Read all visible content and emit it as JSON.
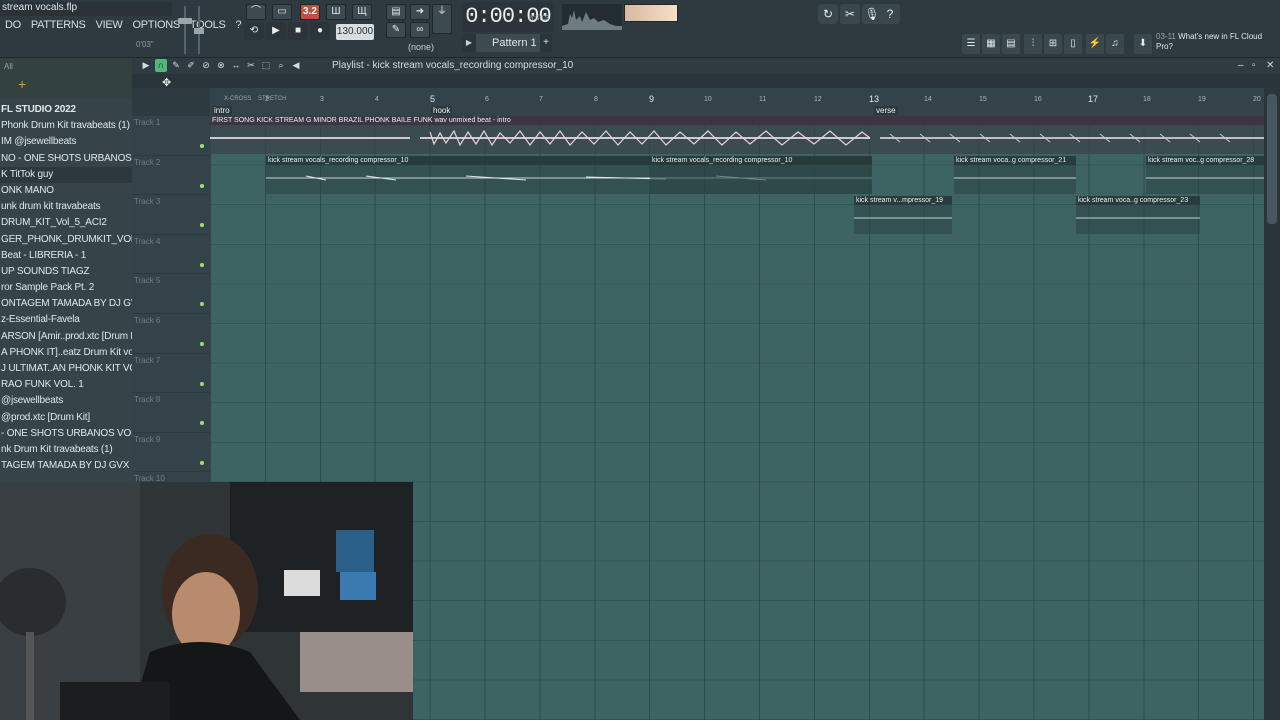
{
  "window": {
    "file_title": "stream vocals.flp"
  },
  "menu": [
    "DO",
    "PATTERNS",
    "VIEW",
    "OPTIONS",
    "TOOLS",
    "?"
  ],
  "hint_sub": "0'03\"",
  "transport": {
    "pat_song": "3.2",
    "tempo": "130.000",
    "time": "0:00:00",
    "time_unit": "M:S:CS",
    "pattern": "Pattern 1",
    "snap": "(none)"
  },
  "news": {
    "date": "03-11",
    "text": "What's new in FL Cloud Pro?"
  },
  "browser": {
    "filter": "All",
    "items": [
      {
        "label": "FL STUDIO 2022",
        "title": true
      },
      {
        "label": "Phonk Drum Kit travabeats (1)"
      },
      {
        "label": "IM @jsewellbeats"
      },
      {
        "label": "NO - ONE SHOTS URBANOS VOL. 2"
      },
      {
        "label": "K TitTok guy",
        "hl": true
      },
      {
        "label": "ONK MANO"
      },
      {
        "label": "unk drum kit travabeats"
      },
      {
        "label": "DRUM_KIT_Vol_5_ACI2"
      },
      {
        "label": "GER_PHONK_DRUMKIT_VOL_3"
      },
      {
        "label": "Beat - LIBRERIA - 1"
      },
      {
        "label": "UP SOUNDS TIAGZ"
      },
      {
        "label": "ror Sample Pack Pt. 2"
      },
      {
        "label": "ONTAGEM TAMADA BY DJ GVX"
      },
      {
        "label": "z-Essential-Favela"
      },
      {
        "label": "ARSON [Amir..prod.xtc [Drum Kit]"
      },
      {
        "label": "A PHONK IT]..eatz Drum Kit vol 1"
      },
      {
        "label": "J ULTIMAT..AN PHONK KIT VOL. 3"
      },
      {
        "label": "RAO FUNK VOL. 1"
      },
      {
        "label": "@jsewellbeats"
      },
      {
        "label": "@prod.xtc [Drum Kit]"
      },
      {
        "label": "- ONE SHOTS URBANOS VOL. 2"
      },
      {
        "label": "nk Drum Kit travabeats (1)"
      },
      {
        "label": "TAGEM TAMADA BY DJ GVX"
      }
    ]
  },
  "playlist": {
    "title": "Playlist - kick stream vocals_recording compressor_10",
    "xcross": "X-CROSS",
    "stretch": "STRETCH",
    "bars": [
      "2",
      "3",
      "4",
      "5",
      "6",
      "7",
      "8",
      "9",
      "10",
      "11",
      "12",
      "13",
      "14",
      "15",
      "16",
      "17",
      "18",
      "19",
      "20"
    ],
    "markers": [
      {
        "label": "intro"
      },
      {
        "label": "hook"
      },
      {
        "label": "verse"
      }
    ],
    "tracks": [
      "Track 1",
      "Track 2",
      "Track 3",
      "Track 4",
      "Track 5",
      "Track 6",
      "Track 7",
      "Track 8",
      "Track 9",
      "Track 10"
    ],
    "clips": {
      "main": "FIRST SONG KICK STREAM G MINOR BRAZIL PHONK BAILE FUNK wav unmixed beat - intro",
      "t2a": "kick stream vocals_recording compressor_10",
      "t2b": "kick stream vocals_recording compressor_10",
      "t2c": "kick stream voca..g compressor_21",
      "t2d": "kick stream voc..g compressor_28",
      "t3a": "kick stream v...mpressor_19",
      "t3b": "kick stream voca..g compressor_23"
    }
  },
  "colors": {
    "grid": "#3d6463",
    "accent": "#9fe36a",
    "panel": "#2d3a3f"
  }
}
